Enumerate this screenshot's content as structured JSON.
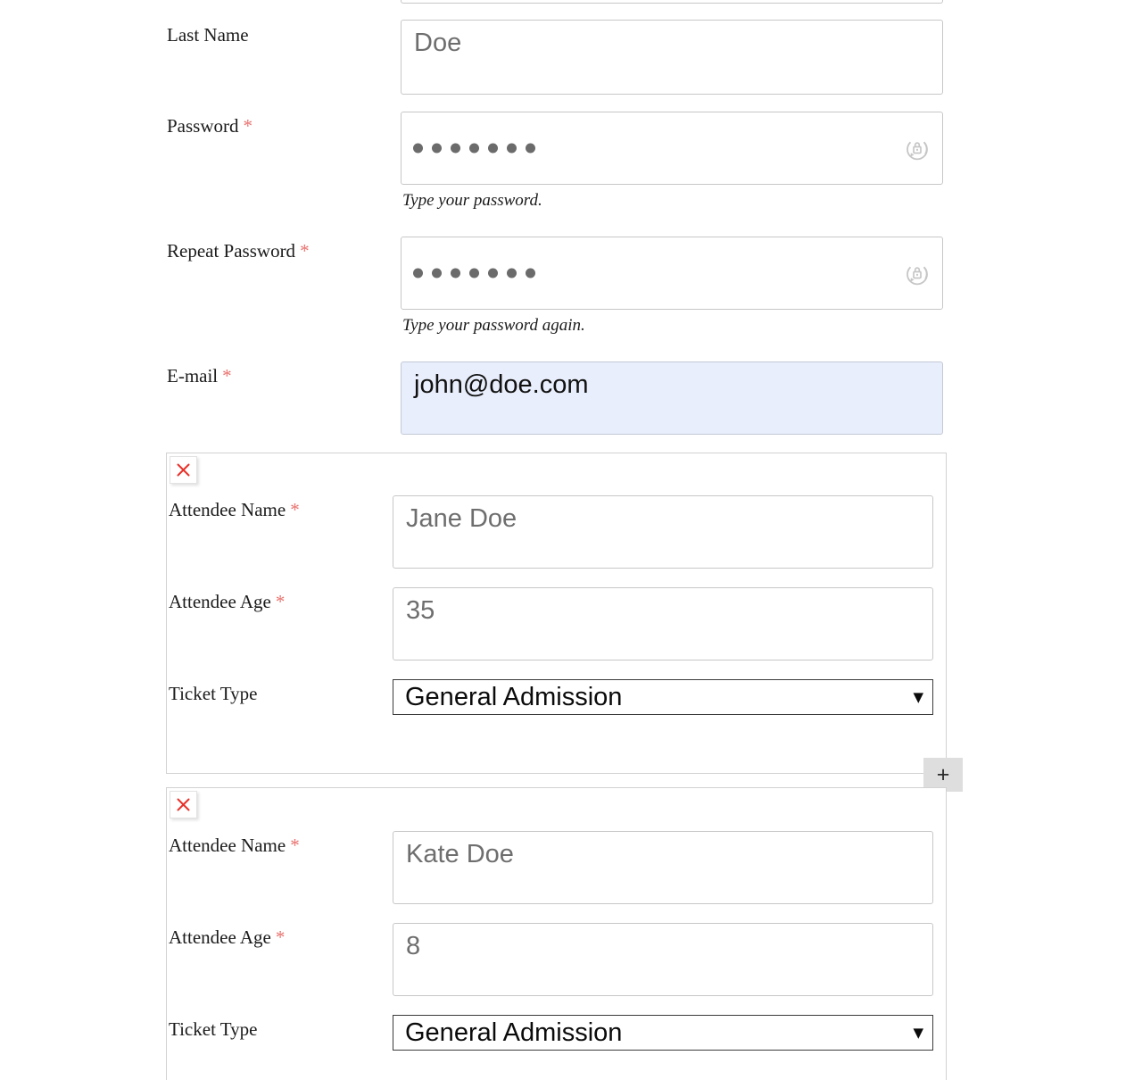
{
  "form": {
    "fields": [
      {
        "id": "last-name",
        "label": "Last Name",
        "required": false,
        "value": "Doe",
        "type": "text"
      },
      {
        "id": "password",
        "label": "Password",
        "required": true,
        "required_mark": "*",
        "type": "password",
        "masked_char_count": 7,
        "help": "Type your password.",
        "icon": "password-manager-lock-icon"
      },
      {
        "id": "repeat-password",
        "label": "Repeat Password",
        "required": true,
        "required_mark": "*",
        "type": "password",
        "masked_char_count": 7,
        "help": "Type your password again.",
        "icon": "password-manager-lock-icon"
      },
      {
        "id": "email",
        "label": "E-mail",
        "required": true,
        "required_mark": "*",
        "value": "john@doe.com",
        "type": "email",
        "autofilled": true
      }
    ]
  },
  "attendees": [
    {
      "index": 1,
      "remove_label": "✕",
      "name": {
        "label": "Attendee Name",
        "required_mark": "*",
        "value": "Jane Doe"
      },
      "age": {
        "label": "Attendee Age",
        "required_mark": "*",
        "value": "35"
      },
      "ticket": {
        "label": "Ticket Type",
        "value": "General Admission"
      }
    },
    {
      "index": 2,
      "remove_label": "✕",
      "name": {
        "label": "Attendee Name",
        "required_mark": "*",
        "value": "Kate Doe"
      },
      "age": {
        "label": "Attendee Age",
        "required_mark": "*",
        "value": "8"
      },
      "ticket": {
        "label": "Ticket Type",
        "value": "General Admission"
      }
    }
  ],
  "add_button": {
    "label": "+",
    "name": "add-attendee-button"
  },
  "colors": {
    "required_asterisk": "#e8726e",
    "remove_x": "#e8312a",
    "autofill_background": "#e8eefb",
    "input_border": "#c7c7c7",
    "fieldset_border": "#d2d2d2",
    "add_button_background": "#dedede",
    "input_text": "#6e6e6e",
    "label_text": "#1b1b1b"
  }
}
